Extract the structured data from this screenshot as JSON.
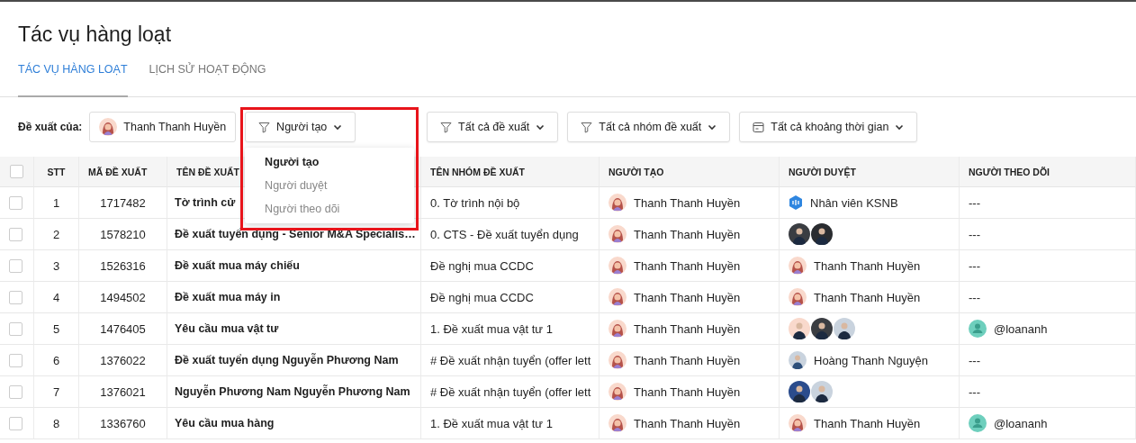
{
  "page": {
    "title": "Tác vụ hàng loạt"
  },
  "tabs": [
    {
      "label": "TÁC VỤ HÀNG LOẠT",
      "selected": true
    },
    {
      "label": "LỊCH SỬ HOẠT ĐỘNG",
      "selected": false
    }
  ],
  "filters": {
    "label": "Đề xuất của:",
    "user": "Thanh Thanh Huyền",
    "buttons": [
      {
        "kind": "filter",
        "label": "Người tạo"
      },
      {
        "kind": "filter",
        "label": "Tất cả đề xuất"
      },
      {
        "kind": "filter",
        "label": "Tất cả nhóm đề xuất"
      },
      {
        "kind": "date",
        "label": "Tất cả khoảng thời gian"
      }
    ]
  },
  "dropdown": {
    "highlighted": true,
    "items": [
      {
        "label": "Người tạo",
        "selected": true
      },
      {
        "label": "Người duyệt",
        "selected": false
      },
      {
        "label": "Người theo dõi",
        "selected": false
      }
    ]
  },
  "table": {
    "all_checked": false,
    "columns": [
      "STT",
      "MÃ ĐỀ XUẤT",
      "TÊN ĐỀ XUẤT",
      "TÊN NHÓM ĐỀ XUẤT",
      "NGƯỜI TẠO",
      "NGƯỜI DUYỆT",
      "NGƯỜI THEO DÕI"
    ],
    "rows": [
      {
        "checked": false,
        "stt": "1",
        "code": "1717482",
        "title": "Tờ trình cử",
        "group": "0. Tờ trình nội bộ",
        "creator": "Thanh Thanh Huyền",
        "approver": {
          "kind": "team",
          "name": "Nhân viên KSNB"
        },
        "follower": {
          "kind": "none",
          "text": "---"
        }
      },
      {
        "checked": false,
        "stt": "2",
        "code": "1578210",
        "title": "Đề xuất tuyển dụng - Senior M&A Specialis…",
        "group": "0. CTS - Đề xuất tuyển dụng",
        "creator": "Thanh Thanh Huyền",
        "approver": {
          "kind": "avatars",
          "avatars": [
            {
              "color": "#3a3d42"
            },
            {
              "color": "#2a2c30"
            }
          ]
        },
        "follower": {
          "kind": "none",
          "text": "---"
        }
      },
      {
        "checked": false,
        "stt": "3",
        "code": "1526316",
        "title": "Đề xuất mua máy chiếu",
        "group": "Đề nghị mua CCDC",
        "creator": "Thanh Thanh Huyền",
        "approver": {
          "kind": "person",
          "name": "Thanh Thanh Huyền"
        },
        "follower": {
          "kind": "none",
          "text": "---"
        }
      },
      {
        "checked": false,
        "stt": "4",
        "code": "1494502",
        "title": "Đề xuất mua máy in",
        "group": "Đề nghị mua CCDC",
        "creator": "Thanh Thanh Huyền",
        "approver": {
          "kind": "person",
          "name": "Thanh Thanh Huyền"
        },
        "follower": {
          "kind": "none",
          "text": "---"
        }
      },
      {
        "checked": false,
        "stt": "5",
        "code": "1476405",
        "title": "Yêu cầu mua vật tư",
        "group": "1. Đề xuất mua vật tư 1",
        "creator": "Thanh Thanh Huyền",
        "approver": {
          "kind": "avatars",
          "avatars": [
            {
              "color": "#f9d9cc"
            },
            {
              "color": "#3a3d42"
            },
            {
              "color": "#c9d3de"
            }
          ]
        },
        "follower": {
          "kind": "user",
          "text": "@loananh"
        }
      },
      {
        "checked": false,
        "stt": "6",
        "code": "1376022",
        "title": "Đề xuất tuyển dụng Nguyễn Phương Nam",
        "group": "# Đề xuất nhận tuyển (offer lett",
        "creator": "Thanh Thanh Huyền",
        "approver": {
          "kind": "photo",
          "name": "Hoàng Thanh Nguyện"
        },
        "follower": {
          "kind": "none",
          "text": "---"
        }
      },
      {
        "checked": false,
        "stt": "7",
        "code": "1376021",
        "title": "Nguyễn Phương Nam Nguyễn Phương Nam",
        "group": "# Đề xuất nhận tuyển (offer lett",
        "creator": "Thanh Thanh Huyền",
        "approver": {
          "kind": "avatars",
          "avatars": [
            {
              "color": "#2b4c8c"
            },
            {
              "color": "#c9d3de"
            }
          ]
        },
        "follower": {
          "kind": "none",
          "text": "---"
        }
      },
      {
        "checked": false,
        "stt": "8",
        "code": "1336760",
        "title": "Yêu cầu mua hàng",
        "group": "1. Đề xuất mua vật tư 1",
        "creator": "Thanh Thanh Huyền",
        "approver": {
          "kind": "person",
          "name": "Thanh Thanh Huyền"
        },
        "follower": {
          "kind": "user",
          "text": "@loananh"
        }
      }
    ]
  }
}
